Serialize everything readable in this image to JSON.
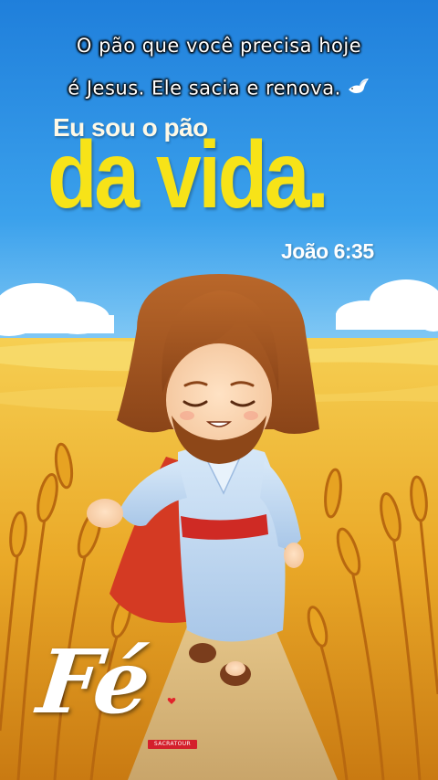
{
  "caption": {
    "line1": "O pão que você precisa hoje",
    "line2": "é Jesus. Ele sacia e renova."
  },
  "verse": {
    "intro": "Eu sou o pão",
    "highlight": "da vida.",
    "reference": "João 6:35"
  },
  "watermark": {
    "signature": "Fé",
    "brand": "SACRATOUR"
  },
  "colors": {
    "sky": "#2f8fe3",
    "wheat": "#e9a723",
    "headline": "#f7e318",
    "robe": "#b9d6f2",
    "sash": "#cf2a24",
    "hair": "#a8561f"
  },
  "icons": [
    "dove-icon",
    "heart-icon"
  ]
}
